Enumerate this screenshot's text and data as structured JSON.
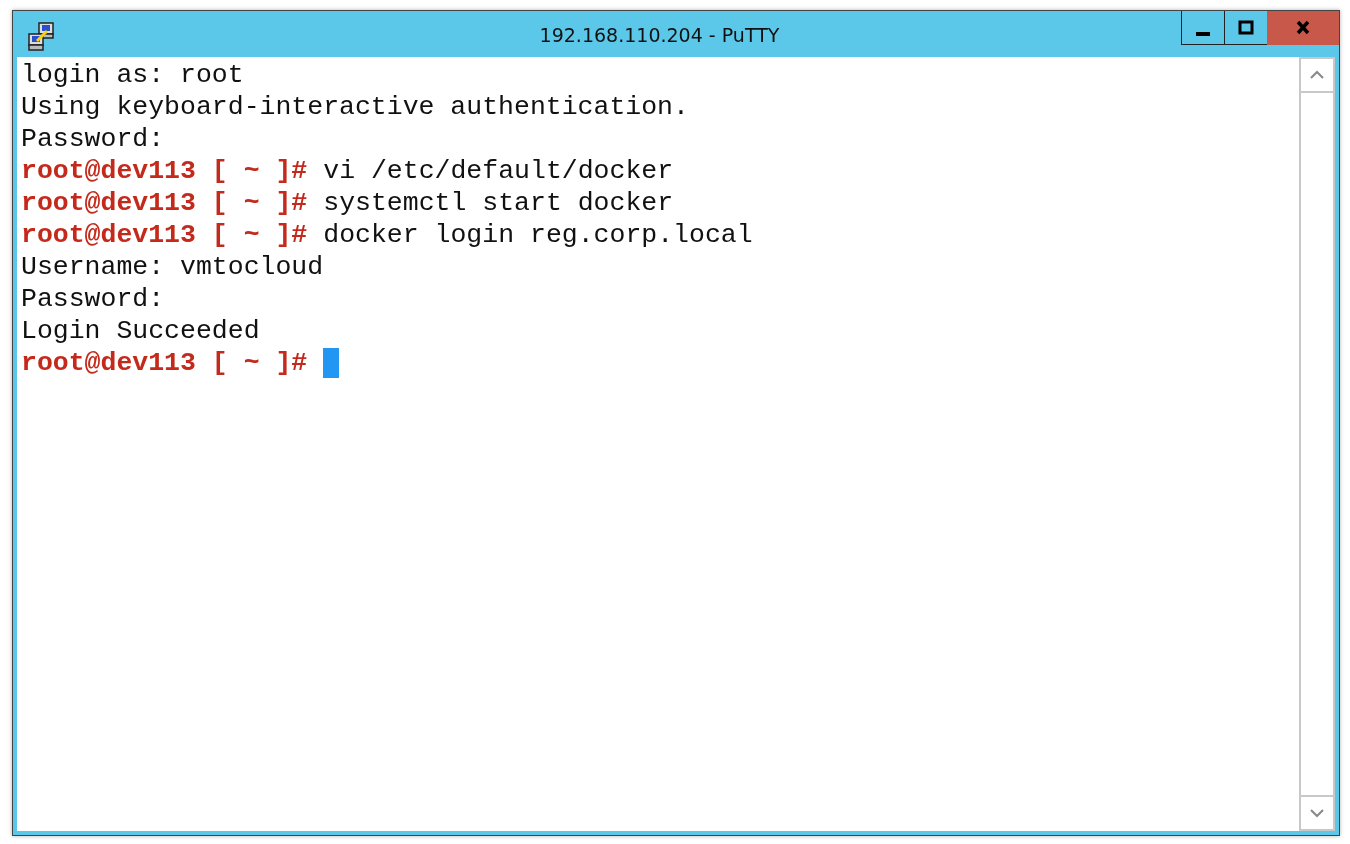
{
  "window": {
    "title": "192.168.110.204 - PuTTY"
  },
  "terminal": {
    "lines": [
      {
        "kind": "output",
        "text": "login as: root",
        "cursor": false
      },
      {
        "kind": "output",
        "text": "Using keyboard-interactive authentication.",
        "cursor": false
      },
      {
        "kind": "output",
        "text": "Password:",
        "cursor": false
      },
      {
        "kind": "prompt",
        "prompt": "root@dev113 [ ~ ]#",
        "command": "vi /etc/default/docker",
        "cursor": false
      },
      {
        "kind": "prompt",
        "prompt": "root@dev113 [ ~ ]#",
        "command": "systemctl start docker",
        "cursor": false
      },
      {
        "kind": "prompt",
        "prompt": "root@dev113 [ ~ ]#",
        "command": "docker login reg.corp.local",
        "cursor": false
      },
      {
        "kind": "output",
        "text": "Username: vmtocloud",
        "cursor": false
      },
      {
        "kind": "output",
        "text": "Password:",
        "cursor": false
      },
      {
        "kind": "output",
        "text": "Login Succeeded",
        "cursor": false
      },
      {
        "kind": "prompt",
        "prompt": "root@dev113 [ ~ ]#",
        "cursor": true
      }
    ]
  }
}
